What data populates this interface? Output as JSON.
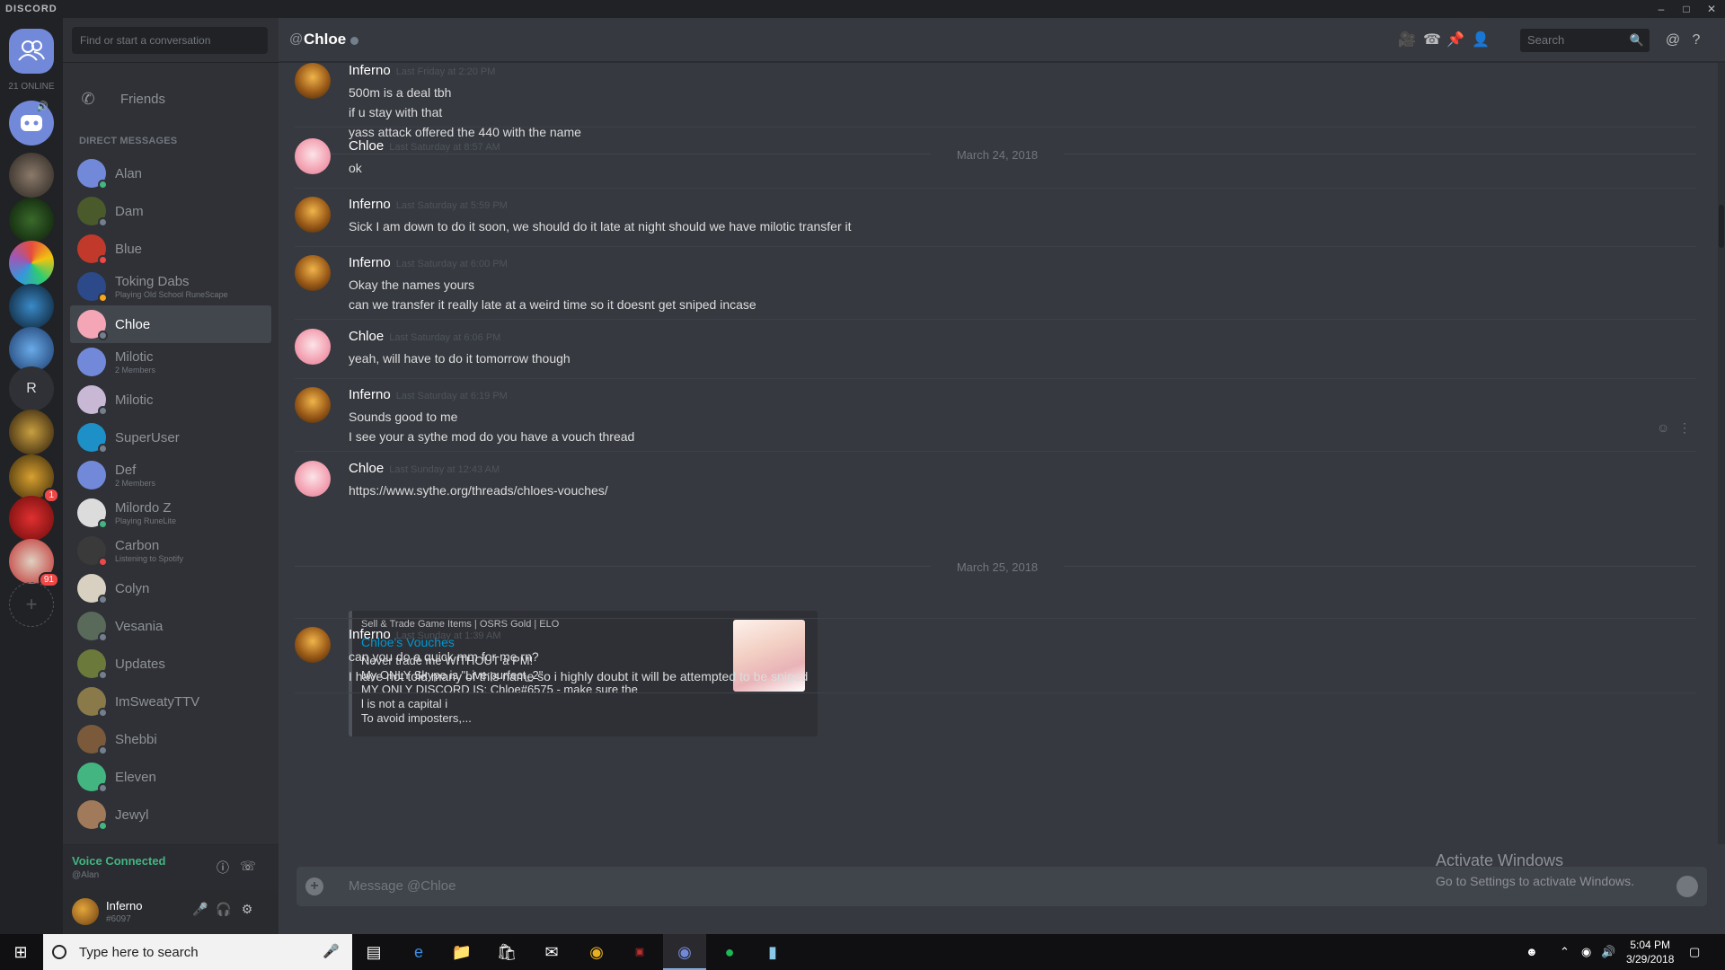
{
  "app": {
    "brand": "DISCORD"
  },
  "guilds": {
    "online_count": "21 ONLINE",
    "letter_server": "R",
    "badge_1": "1",
    "badge_2": "91"
  },
  "sidebar": {
    "search_placeholder": "Find or start a conversation",
    "friends_label": "Friends",
    "dm_header": "DIRECT MESSAGES",
    "dms": [
      {
        "name": "Alan",
        "sub": "",
        "status": "online",
        "active": false,
        "avatar": "#7289da"
      },
      {
        "name": "Dam",
        "sub": "",
        "status": "offline",
        "active": false,
        "avatar": "#4a5a2a"
      },
      {
        "name": "Blue",
        "sub": "",
        "status": "dnd",
        "active": false,
        "avatar": "#c0392b"
      },
      {
        "name": "Toking Dabs",
        "sub": "Playing Old School RuneScape",
        "status": "idle",
        "active": false,
        "avatar": "#2c4a8a"
      },
      {
        "name": "Chloe",
        "sub": "",
        "status": "offline",
        "active": true,
        "avatar": "#f4a6b6"
      },
      {
        "name": "Milotic",
        "sub": "2 Members",
        "status": "none",
        "active": false,
        "avatar": "#7289da"
      },
      {
        "name": "Milotic",
        "sub": "",
        "status": "offline",
        "active": false,
        "avatar": "#c9b7d6"
      },
      {
        "name": "SuperUser",
        "sub": "",
        "status": "offline",
        "active": false,
        "avatar": "#1e90c8"
      },
      {
        "name": "Def",
        "sub": "2 Members",
        "status": "none",
        "active": false,
        "avatar": "#7289da"
      },
      {
        "name": "Milordo Z",
        "sub": "Playing RuneLite",
        "status": "online",
        "active": false,
        "avatar": "#dcdcdc"
      },
      {
        "name": "Carbon",
        "sub": "Listening to Spotify",
        "status": "dnd",
        "active": false,
        "avatar": "#3a3a3a"
      },
      {
        "name": "Colyn",
        "sub": "",
        "status": "offline",
        "active": false,
        "avatar": "#d8d0c0"
      },
      {
        "name": "Vesania",
        "sub": "",
        "status": "offline",
        "active": false,
        "avatar": "#5a6a5a"
      },
      {
        "name": "Updates",
        "sub": "",
        "status": "offline",
        "active": false,
        "avatar": "#6b7a3a"
      },
      {
        "name": "ImSweatyTTV",
        "sub": "",
        "status": "offline",
        "active": false,
        "avatar": "#8a7a4a"
      },
      {
        "name": "Shebbi",
        "sub": "",
        "status": "offline",
        "active": false,
        "avatar": "#7a5a3a"
      },
      {
        "name": "Eleven",
        "sub": "",
        "status": "offline",
        "active": false,
        "avatar": "#43b581"
      },
      {
        "name": "Jewyl",
        "sub": "",
        "status": "online",
        "active": false,
        "avatar": "#a07a5a"
      }
    ],
    "voice_connected": "Voice Connected",
    "voice_sub": "@Alan",
    "user_name": "Inferno",
    "user_tag": "#6097"
  },
  "header": {
    "at_symbol": "@",
    "title": "Chloe",
    "search_placeholder": "Search"
  },
  "messages": {
    "groups": [
      {
        "author": "Inferno",
        "time": "Last Friday at 2:20 PM",
        "lines": [
          "500m is a deal tbh",
          "if u stay with that",
          "yass attack offered  the 440 with the name"
        ]
      },
      {
        "author": "Chloe",
        "time": "Last Saturday at 8:57 AM",
        "lines": [
          "ok"
        ]
      },
      {
        "author": "Inferno",
        "time": "Last Saturday at 5:59 PM",
        "lines": [
          "Sick I am down to do it soon, we should do it late at night should we have milotic transfer it"
        ]
      },
      {
        "author": "Inferno",
        "time": "Last Saturday at 6:00 PM",
        "lines": [
          "Okay the names yours",
          "can we transfer it really late at a weird time so it doesnt get sniped incase"
        ]
      },
      {
        "author": "Chloe",
        "time": "Last Saturday at 6:06 PM",
        "lines": [
          "yeah, will have to do it tomorrow though"
        ]
      },
      {
        "author": "Inferno",
        "time": "Last Saturday at 6:19 PM",
        "lines": [
          "Sounds good to me",
          "I see your a sythe mod do you have a vouch thread"
        ]
      },
      {
        "author": "Chloe",
        "time": "Last Sunday at 12:43 AM",
        "lines": [
          "https://www.sythe.org/threads/chloes-vouches/"
        ]
      },
      {
        "author": "Inferno",
        "time": "Last Sunday at 1:39 AM",
        "lines": [
          "can you do a quick mm for me rn?",
          "I have not told many of this name so i highly doubt it will be attempted to be sniped"
        ]
      }
    ],
    "dividers": [
      "March 24, 2018",
      "March 25, 2018"
    ],
    "embed": {
      "provider": "Sell & Trade Game Items | OSRS Gold | ELO",
      "title": "Chloe's Vouches",
      "desc": [
        "Never trade me WITHOUT a PM!",
        "My ONLY Skype is \"Live:purfect_2\"",
        "MY ONLY DISCORD IS: Chloe#6575 - make sure the l is not a capital i",
        "To avoid imposters,..."
      ]
    }
  },
  "composer": {
    "placeholder": "Message @Chloe"
  },
  "watermark": {
    "line1": "Activate Windows",
    "line2": "Go to Settings to activate Windows."
  },
  "taskbar": {
    "search_placeholder": "Type here to search",
    "time": "5:04 PM",
    "date": "3/29/2018"
  },
  "colors": {
    "online": "#43b581",
    "idle": "#faa61a",
    "dnd": "#f04747",
    "offline": "#747f8d",
    "link": "#0096cf"
  }
}
